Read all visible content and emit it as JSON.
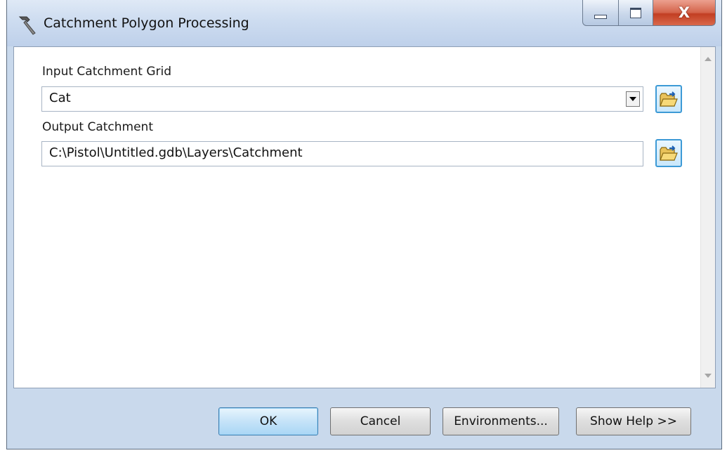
{
  "window": {
    "title": "Catchment Polygon Processing",
    "title_icon": "hammer-icon",
    "controls": {
      "minimize_icon": "minimize-icon",
      "maximize_icon": "maximize-icon",
      "close_label": "X"
    }
  },
  "form": {
    "input_grid": {
      "label": "Input Catchment Grid",
      "value": "Cat"
    },
    "output_catchment": {
      "label": "Output Catchment",
      "value": "C:\\Pistol\\Untitled.gdb\\Layers\\Catchment"
    }
  },
  "buttons": {
    "ok": "OK",
    "cancel": "Cancel",
    "environments": "Environments...",
    "show_help": "Show Help >>"
  },
  "colors": {
    "window_frame": "#c9d9ec",
    "close_button": "#c23e22",
    "ok_button": "#c5e3f8"
  }
}
